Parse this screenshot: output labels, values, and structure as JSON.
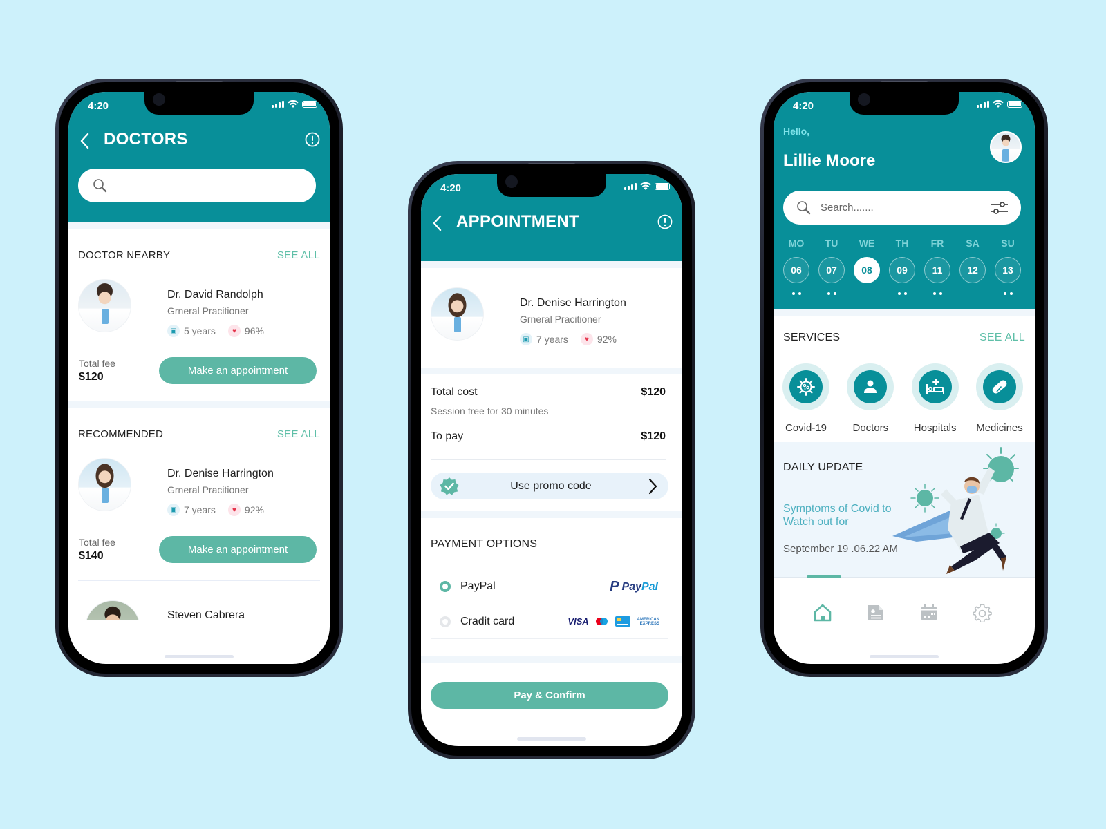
{
  "colors": {
    "background": "#cdf1fb",
    "primary_teal": "#088f99",
    "accent_green": "#5db7a5",
    "text_dark": "#1d1d1d",
    "text_muted": "#777777"
  },
  "status_bar": {
    "time": "4:20"
  },
  "doctors_screen": {
    "title": "DOCTORS",
    "search": {
      "placeholder": "",
      "value": ""
    },
    "nearby": {
      "title": "DOCTOR NEARBY",
      "see_all": "SEE ALL",
      "doctor": {
        "name": "Dr. David Randolph",
        "specialty": "Grneral Pracitioner",
        "experience": "5 years",
        "rating": "96%",
        "fee_label": "Total fee",
        "fee": "$120",
        "button": "Make an appointment"
      }
    },
    "recommended": {
      "title": "RECOMMENDED",
      "see_all": "SEE ALL",
      "doctors": [
        {
          "name": "Dr. Denise Harrington",
          "specialty": "Grneral Pracitioner",
          "experience": "7 years",
          "rating": "92%",
          "fee_label": "Total fee",
          "fee": "$140",
          "button": "Make an appointment"
        },
        {
          "name": "Steven Cabrera"
        }
      ]
    }
  },
  "appointment_screen": {
    "title": "APPOINTMENT",
    "doctor": {
      "name": "Dr. Denise Harrington",
      "specialty": "Grneral Pracitioner",
      "experience": "7 years",
      "rating": "92%"
    },
    "costs": {
      "total_label": "Total cost",
      "total_value": "$120",
      "session_note": "Session free for 30 minutes",
      "to_pay_label": "To pay",
      "to_pay_value": "$120"
    },
    "promo": {
      "label": "Use promo code"
    },
    "payment": {
      "title": "PAYMENT OPTIONS",
      "options": [
        {
          "label": "PayPal",
          "selected": true,
          "brand": "PayPal"
        },
        {
          "label": "Cradit card",
          "selected": false,
          "brands": [
            "VISA",
            "Maestro",
            "Card",
            "American Express"
          ]
        }
      ]
    },
    "confirm_button": "Pay & Confirm"
  },
  "home_screen": {
    "greeting": "Hello,",
    "user_name": "Lillie Moore",
    "search": {
      "placeholder": "Search......."
    },
    "week": [
      {
        "day": "MO",
        "date": "06",
        "dots": 2,
        "active": false
      },
      {
        "day": "TU",
        "date": "07",
        "dots": 2,
        "active": false
      },
      {
        "day": "WE",
        "date": "08",
        "dots": 0,
        "active": true
      },
      {
        "day": "TH",
        "date": "09",
        "dots": 2,
        "active": false
      },
      {
        "day": "FR",
        "date": "11",
        "dots": 2,
        "active": false
      },
      {
        "day": "SA",
        "date": "12",
        "dots": 0,
        "active": false
      },
      {
        "day": "SU",
        "date": "13",
        "dots": 2,
        "active": false
      }
    ],
    "services": {
      "title": "SERVICES",
      "see_all": "SEE ALL",
      "items": [
        {
          "label": "Covid-19",
          "icon": "virus-icon"
        },
        {
          "label": "Doctors",
          "icon": "person-icon"
        },
        {
          "label": "Hospitals",
          "icon": "hospital-bed-icon"
        },
        {
          "label": "Medicines",
          "icon": "pill-icon"
        }
      ]
    },
    "daily_update": {
      "title": "DAILY UPDATE",
      "headline": "Symptoms of Covid to Watch out for",
      "timestamp": "September 19 .06.22 AM"
    },
    "tabbar": [
      "home-icon",
      "document-icon",
      "calendar-icon",
      "settings-icon"
    ]
  }
}
